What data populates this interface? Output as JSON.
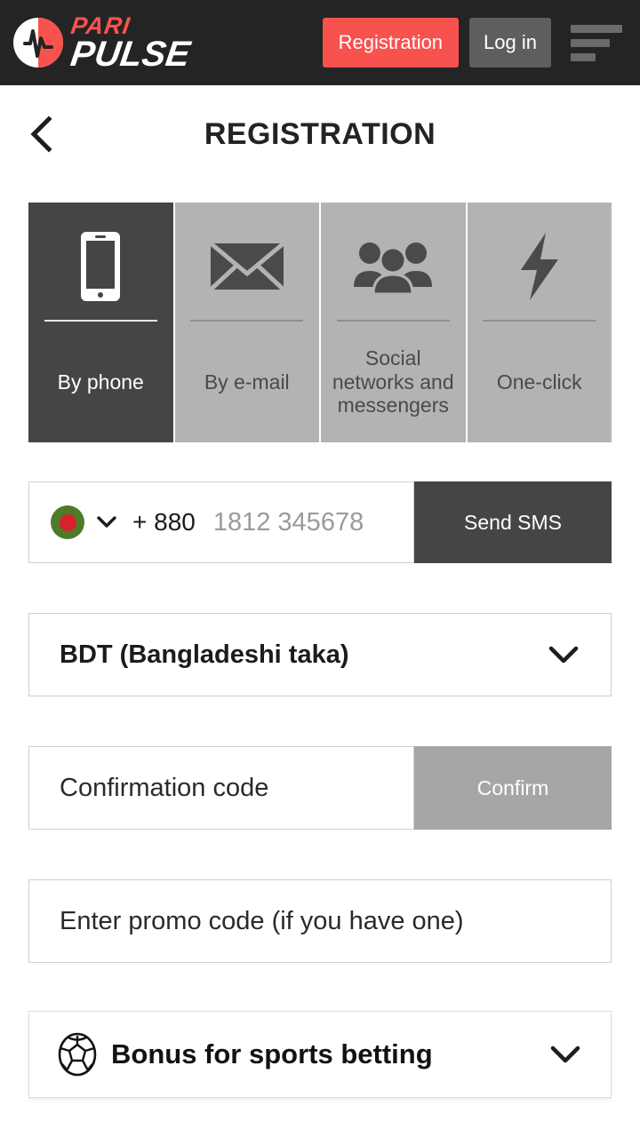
{
  "header": {
    "logo": {
      "top_text": "PARI",
      "bottom_text": "PULSE",
      "mark_name": "paripulse-logo-mark"
    },
    "registration_button": "Registration",
    "login_button": "Log in",
    "menu_icon": "hamburger-menu-icon",
    "background_color": "#242424",
    "accent_color": "#f8524f",
    "login_color": "#5e5e5e"
  },
  "titlebar": {
    "back_icon": "chevron-left-icon",
    "title": "REGISTRATION"
  },
  "tabs": [
    {
      "label": "By phone",
      "icon": "mobile-phone-icon",
      "active": true
    },
    {
      "label": "By e-mail",
      "icon": "envelope-icon",
      "active": false
    },
    {
      "label": "Social networks and messengers",
      "icon": "people-group-icon",
      "active": false
    },
    {
      "label": "One-click",
      "icon": "lightning-bolt-icon",
      "active": false
    }
  ],
  "tab_colors": {
    "active": "#454545",
    "inactive": "#b3b3b3"
  },
  "phone": {
    "flag_icon": "bangladesh-flag-icon",
    "flag_green": "#4f7a28",
    "flag_red": "#d8202f",
    "country_caret_icon": "chevron-down-icon",
    "dial_code": "+ 880",
    "placeholder": "1812 345678",
    "value": "",
    "send_button": "Send SMS"
  },
  "currency": {
    "selected": "BDT (Bangladeshi taka)",
    "caret_icon": "chevron-down-icon"
  },
  "confirmation": {
    "placeholder": "Confirmation code",
    "value": "",
    "button": "Confirm",
    "button_disabled_color": "#a6a6a6"
  },
  "promo": {
    "placeholder": "Enter promo code (if you have one)",
    "value": ""
  },
  "bonus": {
    "icon": "soccer-ball-icon",
    "label": "Bonus for sports betting",
    "caret_icon": "chevron-down-icon"
  }
}
